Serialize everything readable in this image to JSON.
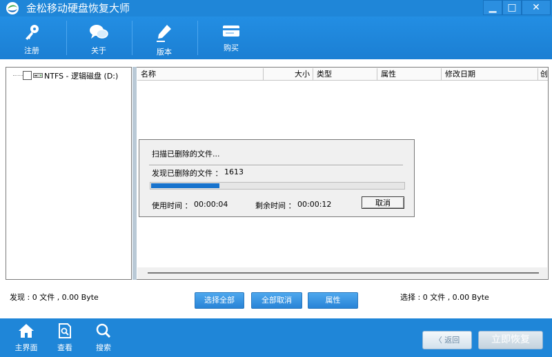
{
  "window": {
    "title": "金松移动硬盘恢复大师",
    "minimize_glyph": "▁",
    "maximize_glyph": "□",
    "close_glyph": "✕"
  },
  "toolbar": {
    "items": [
      {
        "label": "注册",
        "icon": "key-icon"
      },
      {
        "label": "关于",
        "icon": "chat-bubbles-icon"
      },
      {
        "label": "版本",
        "icon": "pen-icon"
      },
      {
        "label": "购买",
        "icon": "card-icon"
      }
    ]
  },
  "tree": {
    "nodes": [
      {
        "label": "NTFS - 逻辑磁盘 (D:)",
        "checked": false,
        "icon": "drive-icon"
      }
    ]
  },
  "file_list": {
    "columns": [
      "名称",
      "大小",
      "类型",
      "属性",
      "修改日期",
      "创"
    ],
    "rows": []
  },
  "scan_dialog": {
    "title": "扫描已删除的文件...",
    "found_label": "发现已删除的文件 ：",
    "found_count": "1613",
    "progress_fraction": 0.27,
    "elapsed_label": "使用时间 ：",
    "elapsed_value": "00:00:04",
    "remaining_label": "剩余时间 ：",
    "remaining_value": "00:00:12",
    "cancel_label": "取消"
  },
  "status": {
    "found": "发现 : 0 文件 , 0.00 Byte",
    "selected": "选择 : 0 文件 , 0.00 Byte"
  },
  "actions": {
    "select_all": "选择全部",
    "deselect_all": "全部取消",
    "properties": "属性"
  },
  "bottom_nav": {
    "items": [
      {
        "label": "主界面",
        "icon": "home-icon"
      },
      {
        "label": "查看",
        "icon": "document-search-icon"
      },
      {
        "label": "搜索",
        "icon": "magnifier-icon"
      }
    ],
    "back_label": "返回",
    "back_glyph": "〈",
    "restore_label": "立即恢复"
  },
  "colors": {
    "brand_blue": "#1f86d8",
    "progress": "#1873cd"
  }
}
